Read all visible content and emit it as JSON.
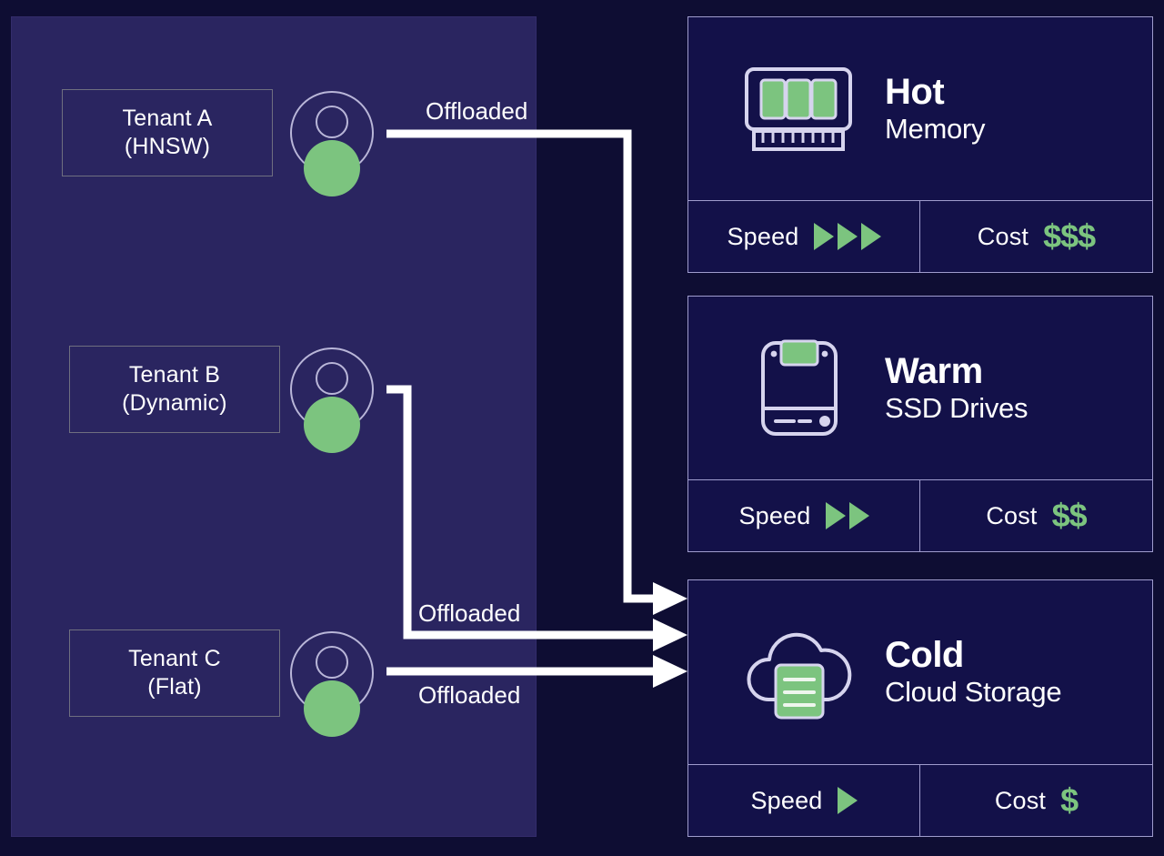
{
  "colors": {
    "page_background": "#0e0d33",
    "panel_background": "#2a2560",
    "card_background": "#131149",
    "card_border": "#9f9ccd",
    "accent_green": "#7cc47f",
    "text_white": "#ffffff",
    "tenant_box_border": "#6f6f80"
  },
  "tenants": [
    {
      "name": "Tenant A",
      "strategy": "(HNSW)",
      "avatar_icon": "user-avatar-icon"
    },
    {
      "name": "Tenant B",
      "strategy": "(Dynamic)",
      "avatar_icon": "user-avatar-icon"
    },
    {
      "name": "Tenant C",
      "strategy": "(Flat)",
      "avatar_icon": "user-avatar-icon"
    }
  ],
  "connections": [
    {
      "from": "Tenant A",
      "to": "Cold",
      "label": "Offloaded"
    },
    {
      "from": "Tenant B",
      "to": "Cold",
      "label": "Offloaded"
    },
    {
      "from": "Tenant C",
      "to": "Cold",
      "label": "Offloaded"
    }
  ],
  "tiers": [
    {
      "title": "Hot",
      "subtitle": "Memory",
      "icon": "ram-memory-stick-icon",
      "speed_label": "Speed",
      "speed_level": 3,
      "cost_label": "Cost",
      "cost_value": "$$$"
    },
    {
      "title": "Warm",
      "subtitle": "SSD Drives",
      "icon": "ssd-drive-icon",
      "speed_label": "Speed",
      "speed_level": 2,
      "cost_label": "Cost",
      "cost_value": "$$"
    },
    {
      "title": "Cold",
      "subtitle": "Cloud Storage",
      "icon": "cloud-storage-icon",
      "speed_label": "Speed",
      "speed_level": 1,
      "cost_label": "Cost",
      "cost_value": "$"
    }
  ]
}
